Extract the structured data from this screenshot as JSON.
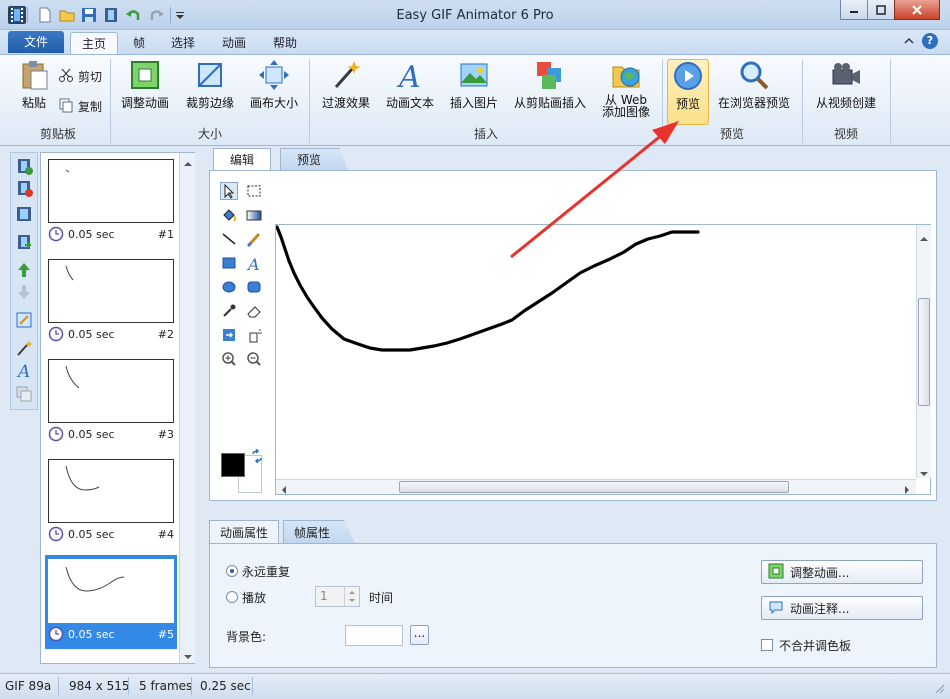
{
  "window": {
    "title": "Easy GIF Animator 6 Pro"
  },
  "quick_access": {
    "icons": [
      "app-film-icon",
      "new-file-icon",
      "open-folder-icon",
      "save-icon",
      "undo-icon",
      "redo-icon",
      "customize-icon"
    ]
  },
  "menu_tabs": [
    "文件",
    "主页",
    "帧",
    "选择",
    "动画",
    "帮助"
  ],
  "active_tab": "主页",
  "ribbon": {
    "clipboard": {
      "group": "剪贴板",
      "paste": "粘贴",
      "cut": "剪切",
      "copy": "复制"
    },
    "size": {
      "group": "大小",
      "resize": "调整动画",
      "crop": "裁剪边缘",
      "canvas": "画布大小"
    },
    "insert": {
      "group": "插入",
      "transition": "过渡效果",
      "text": "动画文本",
      "image": "插入图片",
      "from_clipboard": "从剪贴画插入",
      "from_web_1": "从 Web",
      "from_web_2": "添加图像"
    },
    "preview": {
      "group": "预览",
      "preview": "预览",
      "browser": "在浏览器预览"
    },
    "video": {
      "group": "视频",
      "from_video": "从视频创建"
    }
  },
  "frames": [
    {
      "time": "0.05 sec",
      "num": "#1"
    },
    {
      "time": "0.05 sec",
      "num": "#2"
    },
    {
      "time": "0.05 sec",
      "num": "#3"
    },
    {
      "time": "0.05 sec",
      "num": "#4"
    },
    {
      "time": "0.05 sec",
      "num": "#5"
    }
  ],
  "editor_tabs": {
    "edit": "编辑",
    "preview": "预览"
  },
  "props_tabs": {
    "anim": "动画属性",
    "frame": "帧属性"
  },
  "props": {
    "repeat_forever": "永远重复",
    "play": "播放",
    "play_count": "1",
    "times": "时间",
    "bg_color": "背景色:",
    "browse": "...",
    "resize_btn": "调整动画...",
    "comment_btn": "动画注释...",
    "no_palette": "不合并调色板"
  },
  "status": {
    "format": "GIF 89a",
    "size": "984 x 515",
    "frames": "5 frames",
    "duration": "0.25 sec"
  },
  "colors": {
    "accent": "#3389e5",
    "arrow": "#e8322c",
    "primary_color": "#000000",
    "secondary_color": "#ffffff"
  }
}
